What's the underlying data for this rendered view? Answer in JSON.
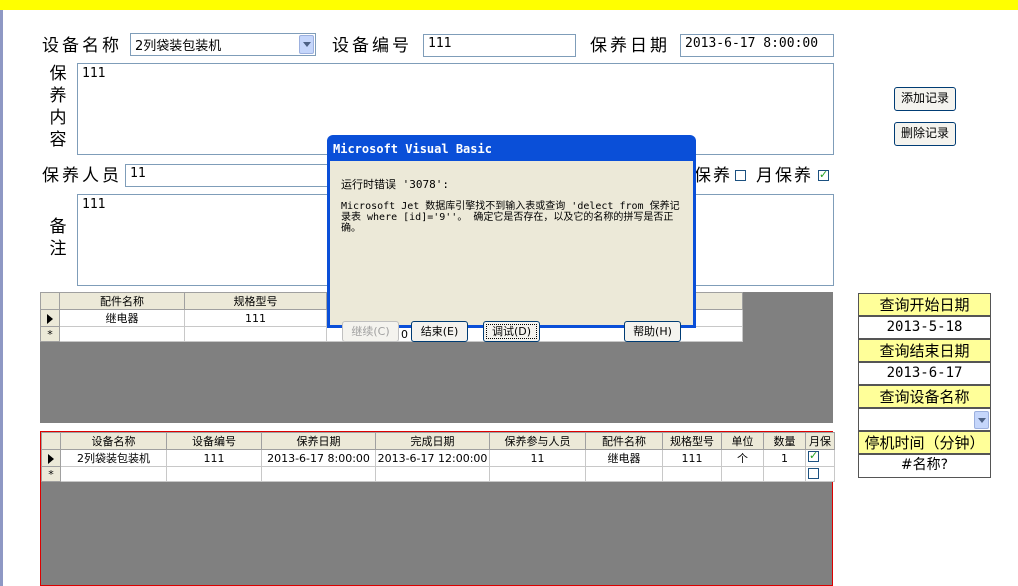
{
  "form": {
    "device_name_label": "设备名称",
    "device_name_value": "2列袋装包装机",
    "device_no_label": "设备编号",
    "device_no_value": "111",
    "maint_date_label": "保养日期",
    "maint_date_value": "2013-6-17 8:00:00",
    "content_label_chars": [
      "保",
      "养",
      "内",
      "容"
    ],
    "content_value": "111",
    "person_label": "保养人员",
    "person_value": "11",
    "week_maint_label": "保养",
    "week_maint_checked": false,
    "month_maint_label": "月保养",
    "month_maint_checked": true,
    "remark_label_chars": [
      "备",
      "注"
    ],
    "remark_value": "111",
    "add_button": "添加记录",
    "delete_button": "删除记录"
  },
  "parts_grid": {
    "columns": [
      "配件名称",
      "规格型号"
    ],
    "rows": [
      {
        "name": "继电器",
        "spec": "111"
      }
    ],
    "new_row_value": "0"
  },
  "records_grid": {
    "columns": [
      "设备名称",
      "设备编号",
      "保养日期",
      "完成日期",
      "保养参与人员",
      "配件名称",
      "规格型号",
      "单位",
      "数量",
      "月保"
    ],
    "rows": [
      {
        "device": "2列袋装包装机",
        "no": "111",
        "date": "2013-6-17 8:00:00",
        "done": "2013-6-17 12:00:00",
        "people": "11",
        "part": "继电器",
        "spec": "111",
        "unit": "个",
        "qty": "1",
        "monthly": true
      }
    ]
  },
  "query": {
    "start_label": "查询开始日期",
    "start_value": "2013-5-18",
    "end_label": "查询结束日期",
    "end_value": "2013-6-17",
    "device_label": "查询设备名称",
    "device_value": "",
    "downtime_label": "停机时间（分钟）",
    "downtime_value": "#名称?"
  },
  "dialog": {
    "title": "Microsoft Visual Basic",
    "error_line": "运行时错误 '3078':",
    "message": "Microsoft Jet 数据库引擎找不到输入表或查询 'delect from 保养记录表 where [id]='9''。 确定它是否存在，以及它的名称的拼写是否正确。",
    "continue_button": "继续(C)",
    "end_button": "结束(E)",
    "debug_button": "调试(D)",
    "help_button": "帮助(H)"
  },
  "colors": {
    "topbar": "#ffff00",
    "dialog_title": "#0a4fd8",
    "query_header": "#ffff99",
    "grid_background": "#808080"
  }
}
